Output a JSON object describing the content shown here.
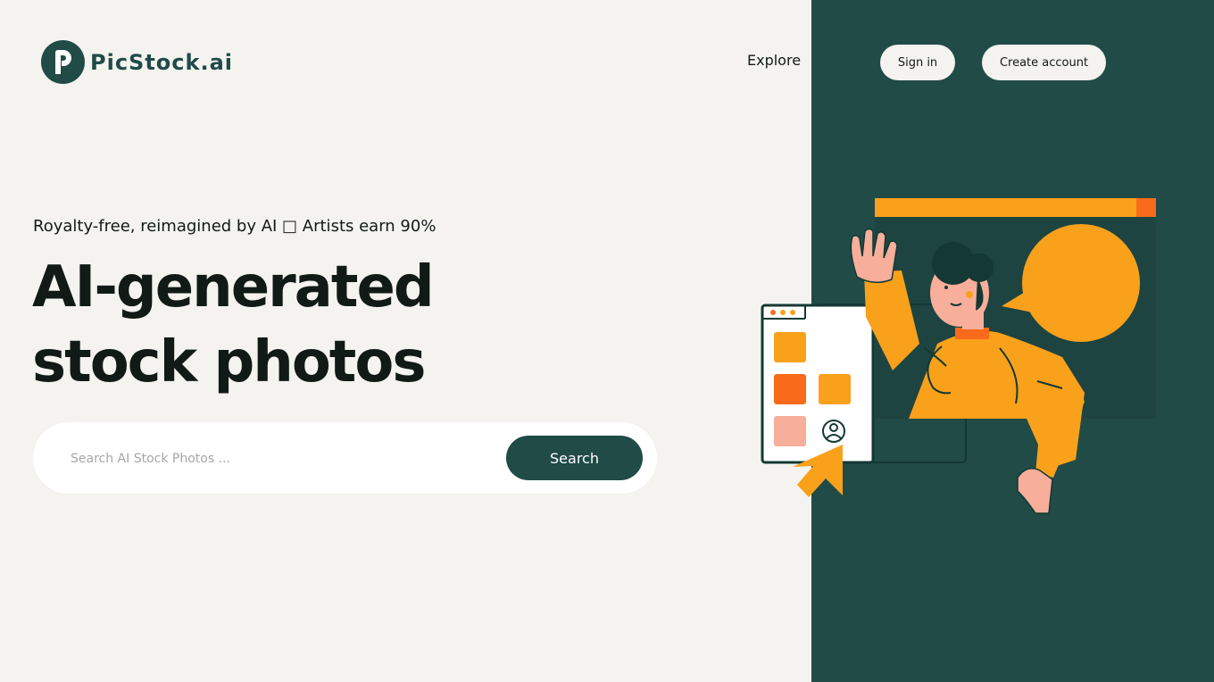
{
  "header": {
    "logo_text": "PicStock.ai",
    "logo_icon": "picstock-logo-icon",
    "nav_explore": "Explore",
    "sign_in": "Sign in",
    "create_account": "Create account"
  },
  "hero": {
    "tagline": "Royalty-free, reimagined by AI □ Artists earn 90%",
    "headline_line1": "AI-generated",
    "headline_line2": "stock photos"
  },
  "search": {
    "placeholder": "Search AI Stock Photos ...",
    "value": "",
    "button_label": "Search"
  },
  "illustration": {
    "icon": "person-waving-illustration",
    "colors": {
      "panel": "#204b47",
      "orange": "#f9a11b",
      "dark_orange": "#f96a1b",
      "pink": "#f7ae9a"
    }
  },
  "colors": {
    "background": "#f4f3ef",
    "brand": "#204b47",
    "text": "#111a17",
    "button_bg": "#f4f3ef"
  }
}
